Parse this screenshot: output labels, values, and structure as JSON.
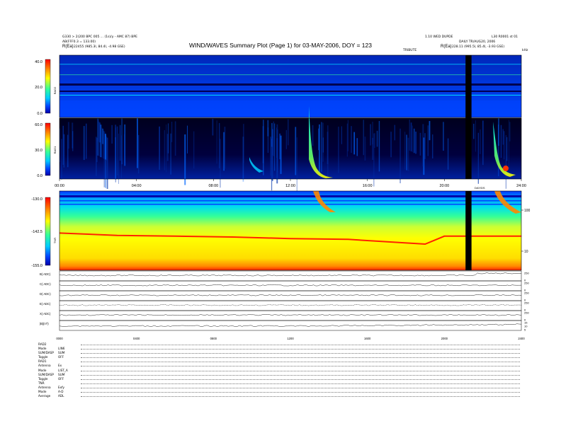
{
  "header": {
    "title": "WIND/WAVES Summary Plot (Page 1) for 03-MAY-2006, DOY = 123",
    "left_line1": "G330 > 2(200 BPC 005 ... (1s)/y - AMC 87) BPE",
    "left_line2": "AB(FFF0.3 = 133.00)",
    "left_rbar": "R(Ea)",
    "left_rvals": "22455 (985.3l, 84.4l, -4.98 GSE)",
    "right_line1": "1.10 WED DUPDE",
    "right_line2": "L30 R0001 st 01",
    "right_line3": "DAILY TR/AUG20, 2006",
    "right_rbar": "R(Ea)",
    "right_rvals": "228.11 (995.5l, 85.4l, -3.93 GSE)",
    "tribute_label": "TRIBUTE",
    "kHz_label": "kHz",
    "rad2_marker": "DAY/DS"
  },
  "panels": [
    {
      "name": "RAD2",
      "ylabel": "RAD2",
      "colorbar_ticks": [
        "40.0",
        "20.0",
        "0.0"
      ]
    },
    {
      "name": "RAD1",
      "ylabel": "RAD1",
      "colorbar_ticks": [
        "60.0",
        "30.0",
        "0.0"
      ]
    },
    {
      "name": "TNR",
      "ylabel": "TNR",
      "colorbar_ticks": [
        "-130.0",
        "-142.5",
        "-155.0"
      ],
      "right_ticks": [
        "100",
        "10"
      ]
    }
  ],
  "time_axis": {
    "ticks": [
      "00:00",
      "04:00",
      "08:00",
      "12:00",
      "16:00",
      "20:00",
      "24:00"
    ]
  },
  "bottom_time_axis": {
    "ticks": [
      "0000",
      "0400",
      "0800",
      "1200",
      "1600",
      "2000",
      "2400"
    ]
  },
  "line_panels": [
    {
      "label": "B( ADC)",
      "right_ticks": [
        "250",
        "0"
      ]
    },
    {
      "label": "C( ADC)",
      "right_ticks": [
        "250",
        "0"
      ]
    },
    {
      "label": "D( ADC)",
      "right_ticks": [
        "250",
        "0"
      ]
    },
    {
      "label": "E( ADC)",
      "right_ticks": [
        "250",
        "0"
      ]
    },
    {
      "label": "X( ADC)",
      "right_ticks": [
        "250",
        "0"
      ]
    },
    {
      "label": "|B|(nT)",
      "right_ticks": [
        "15",
        "10",
        "5"
      ]
    }
  ],
  "status_block": [
    {
      "key": "RAD2",
      "value": ""
    },
    {
      "key": "Mode",
      "value": "LIN6"
    },
    {
      "key": "SUM/DASP",
      "value": "SUM"
    },
    {
      "key": "Toggle",
      "value": "OFF"
    },
    {
      "key": "RAD1",
      "value": ""
    },
    {
      "key": "Antenna",
      "value": "Ex"
    },
    {
      "key": "Mode",
      "value": "LIST_A"
    },
    {
      "key": "SUM/DASP",
      "value": "SUM"
    },
    {
      "key": "Toggle",
      "value": "OFF"
    },
    {
      "key": "TNR",
      "value": ""
    },
    {
      "key": "Antenna",
      "value": "Exfy"
    },
    {
      "key": "Mode",
      "value": "A-D"
    },
    {
      "key": "Average",
      "value": "ADL"
    }
  ],
  "chart_data": {
    "type": "heatmap",
    "title": "WIND/WAVES Summary Plot (Page 1) for 03-MAY-2006, DOY = 123",
    "x_range_hours": [
      0,
      24
    ],
    "data_gap_hours": [
      21.1,
      21.3
    ],
    "radio_bursts_hours": [
      10.0,
      12.9,
      22.8,
      23.6
    ],
    "tnr_plasma_line_hours": [
      0,
      3,
      6,
      9,
      12,
      15,
      19,
      20,
      24
    ],
    "tnr_plasma_line_level": [
      0.47,
      0.44,
      0.43,
      0.42,
      0.4,
      0.39,
      0.33,
      0.43,
      0.43
    ],
    "colormap": [
      "#000020",
      "#0000aa",
      "#0044ff",
      "#00ccff",
      "#33ff99",
      "#ffff00",
      "#ff8800",
      "#ff0000"
    ]
  },
  "colors": {
    "rad_bg": "#0033d6",
    "rad1_bg": "#000030",
    "gap": "#000000"
  }
}
